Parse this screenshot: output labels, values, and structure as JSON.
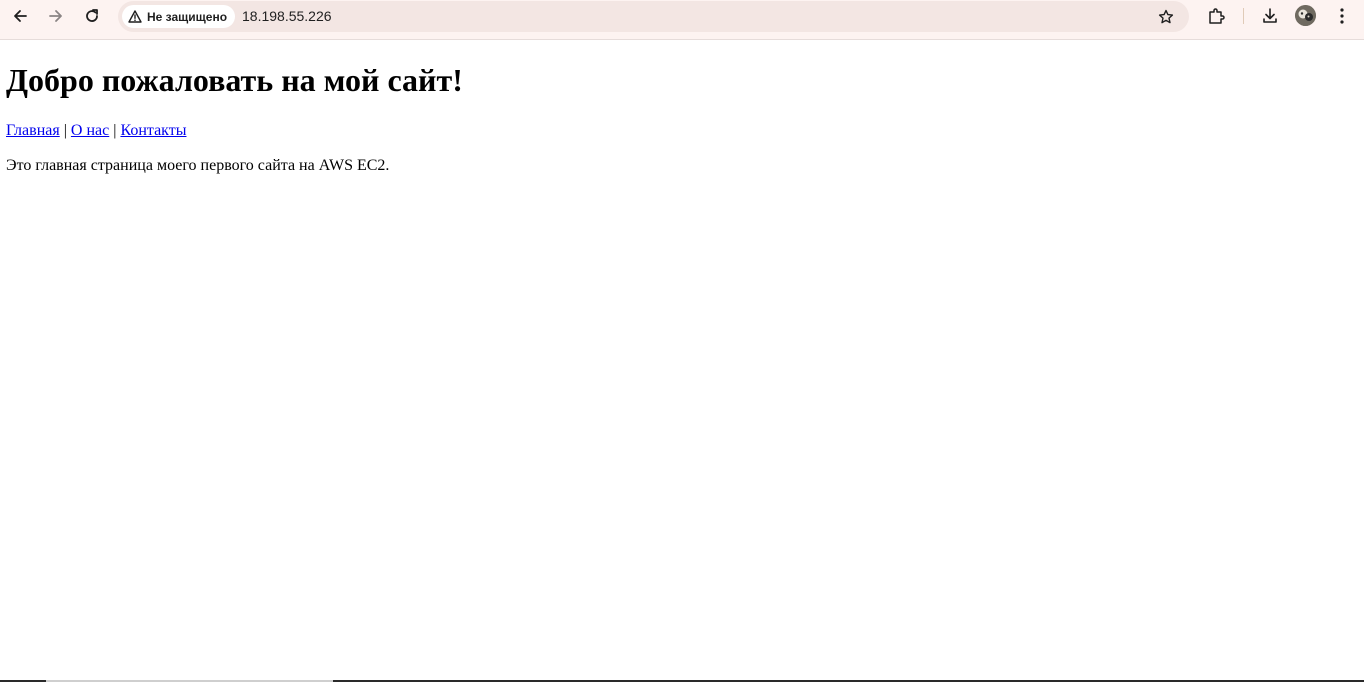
{
  "browser": {
    "back_icon": "arrow-left-icon",
    "forward_icon": "arrow-right-icon",
    "reload_icon": "reload-icon",
    "security_icon": "warning-triangle-icon",
    "security_label": "Не защищено",
    "url": "18.198.55.226",
    "bookmark_icon": "star-icon",
    "extensions_icon": "puzzle-icon",
    "downloads_icon": "download-icon",
    "profile_icon": "avatar",
    "menu_icon": "kebab-menu-icon",
    "toolbar_color": "#fdf3f1",
    "omnibox_color": "#f3e6e3"
  },
  "page": {
    "heading": "Добро пожаловать на мой сайт!",
    "nav": {
      "links": [
        {
          "label": "Главная"
        },
        {
          "label": "О нас"
        },
        {
          "label": "Контакты"
        }
      ],
      "separator": " | "
    },
    "intro": "Это главная страница моего первого сайта на AWS EC2.",
    "link_color": "#0000ee"
  }
}
